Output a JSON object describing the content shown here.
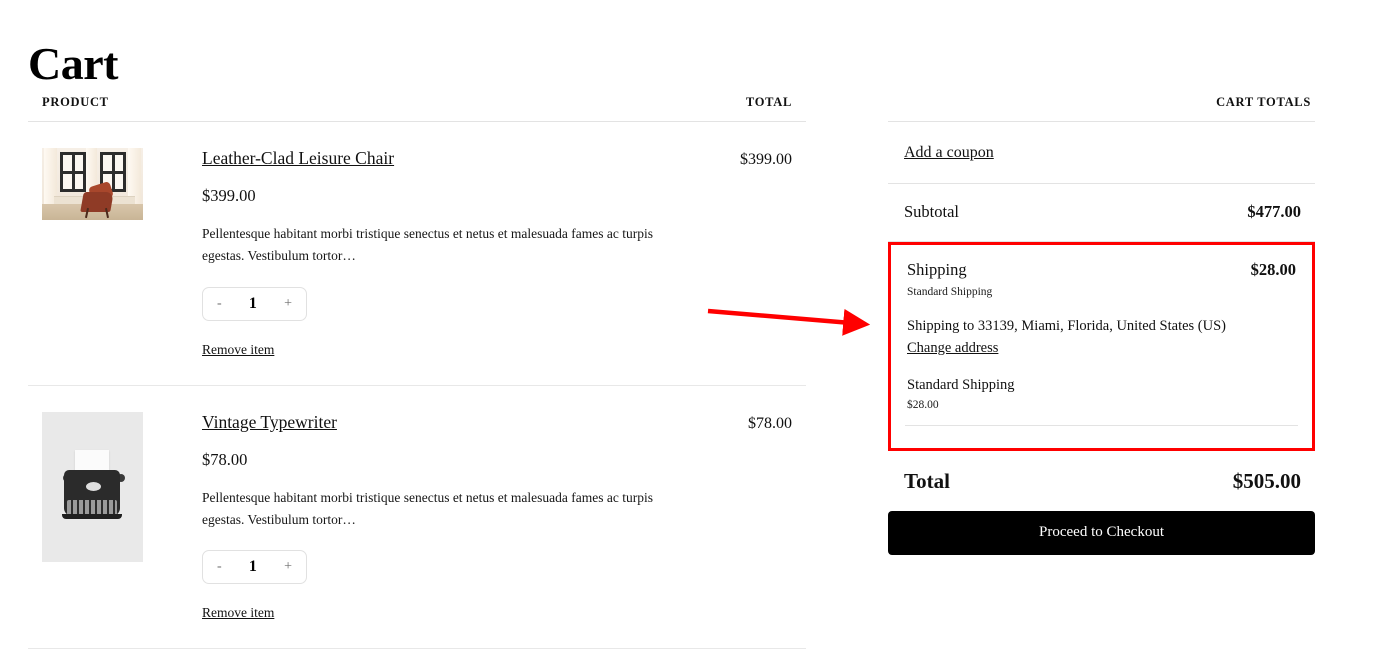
{
  "page": {
    "title": "Cart"
  },
  "cart_table": {
    "headers": {
      "product": "PRODUCT",
      "total": "TOTAL"
    },
    "items": [
      {
        "name": "Leather-Clad Leisure Chair",
        "price": "$399.00",
        "description": "Pellentesque habitant morbi tristique senectus et netus et malesuada fames ac turpis egestas. Vestibulum tortor…",
        "quantity": "1",
        "decrement_label": "-",
        "increment_label": "+",
        "remove_label": "Remove item",
        "line_total": "$399.00",
        "image_alt": "leather butterfly chair in sunlit room"
      },
      {
        "name": "Vintage Typewriter",
        "price": "$78.00",
        "description": "Pellentesque habitant morbi tristique senectus et netus et malesuada fames ac turpis egestas. Vestibulum tortor…",
        "quantity": "1",
        "decrement_label": "-",
        "increment_label": "+",
        "remove_label": "Remove item",
        "line_total": "$78.00",
        "image_alt": "black vintage typewriter with paper"
      }
    ]
  },
  "cart_totals": {
    "heading": "CART TOTALS",
    "coupon_link": "Add a coupon",
    "subtotal_label": "Subtotal",
    "subtotal_value": "$477.00",
    "shipping": {
      "label": "Shipping",
      "value": "$28.00",
      "method_caption": "Standard Shipping",
      "shipping_to": "Shipping to 33139, Miami, Florida, United States (US)",
      "change_address_link": "Change address",
      "option_name": "Standard Shipping",
      "option_price": "$28.00",
      "highlight_color": "#ff0000"
    },
    "total_label": "Total",
    "total_value": "$505.00",
    "checkout_button": "Proceed to Checkout"
  },
  "annotation": {
    "arrow_color": "#ff0000",
    "points_to": "shipping"
  }
}
